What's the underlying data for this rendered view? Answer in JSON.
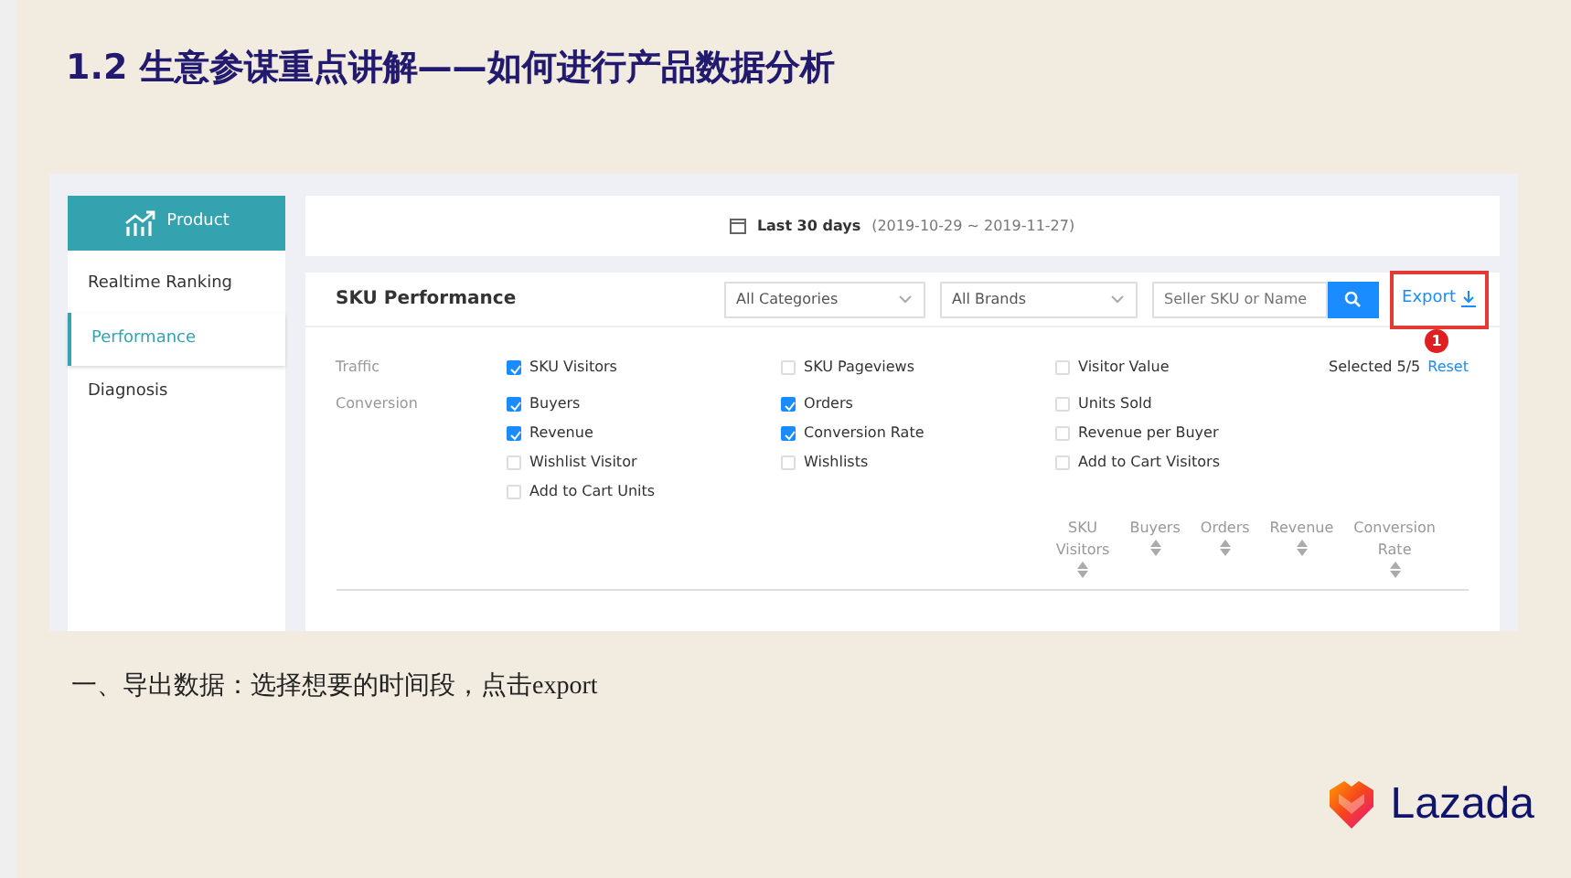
{
  "slide_title": "1.2  生意参谋重点讲解——如何进行产品数据分析",
  "sidebar": {
    "header": "Product",
    "items": [
      {
        "label": "Realtime Ranking",
        "selected": false
      },
      {
        "label": "Performance",
        "selected": true
      },
      {
        "label": "Diagnosis",
        "selected": false
      }
    ]
  },
  "date_range": {
    "label": "Last 30 days",
    "range": "(2019-10-29 ~ 2019-11-27)"
  },
  "panel": {
    "title": "SKU Performance",
    "category_select": "All Categories",
    "brand_select": "All Brands",
    "search": {
      "placeholder": "Seller SKU or Name"
    },
    "export": "Export",
    "callout_number": "1"
  },
  "metric_groups": [
    {
      "label": "Traffic",
      "options": [
        {
          "label": "SKU Visitors",
          "checked": true
        },
        {
          "label": "SKU Pageviews",
          "checked": false
        },
        {
          "label": "Visitor Value",
          "checked": false
        }
      ]
    },
    {
      "label": "Conversion",
      "options": [
        {
          "label": "Buyers",
          "checked": true
        },
        {
          "label": "Orders",
          "checked": true
        },
        {
          "label": "Units Sold",
          "checked": false
        },
        {
          "label": "Revenue",
          "checked": true
        },
        {
          "label": "Conversion Rate",
          "checked": true
        },
        {
          "label": "Revenue per Buyer",
          "checked": false
        },
        {
          "label": "Wishlist Visitor",
          "checked": false
        },
        {
          "label": "Wishlists",
          "checked": false
        },
        {
          "label": "Add to Cart Visitors",
          "checked": false
        },
        {
          "label": "Add to Cart Units",
          "checked": false
        }
      ]
    }
  ],
  "selected_count": "Selected 5/5",
  "reset": "Reset",
  "table": {
    "columns": [
      [
        "SKU",
        "Visitors"
      ],
      [
        "Buyers"
      ],
      [
        "Orders"
      ],
      [
        "Revenue"
      ],
      [
        "Conversion",
        "Rate"
      ]
    ]
  },
  "caption": "一、导出数据：选择想要的时间段，点击export",
  "logo": "Lazada"
}
